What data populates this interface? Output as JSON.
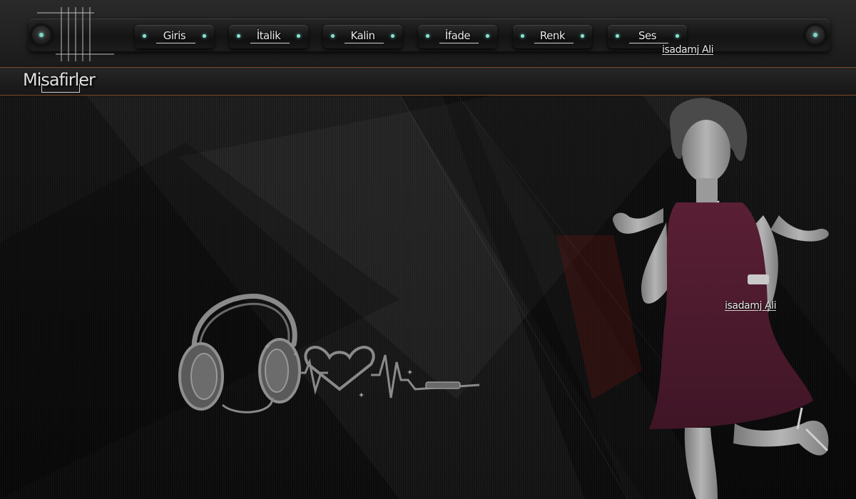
{
  "nav": {
    "items": [
      {
        "label": "Giris"
      },
      {
        "label": "İtalik"
      },
      {
        "label": "Kalin"
      },
      {
        "label": "İfade"
      },
      {
        "label": "Renk"
      },
      {
        "label": "Ses"
      }
    ]
  },
  "signature": {
    "top": "isadamj Ali",
    "figure": "isadamj Ali"
  },
  "guest_bar": {
    "label": "Misafirler"
  },
  "colors": {
    "accent_teal": "#7fd7c8",
    "divider_copper": "#7a4a2a",
    "dress": "#5a1f35"
  },
  "icons": {
    "headphones": "headphones-heartbeat-icon",
    "strings": "guitar-strings-decoration"
  }
}
